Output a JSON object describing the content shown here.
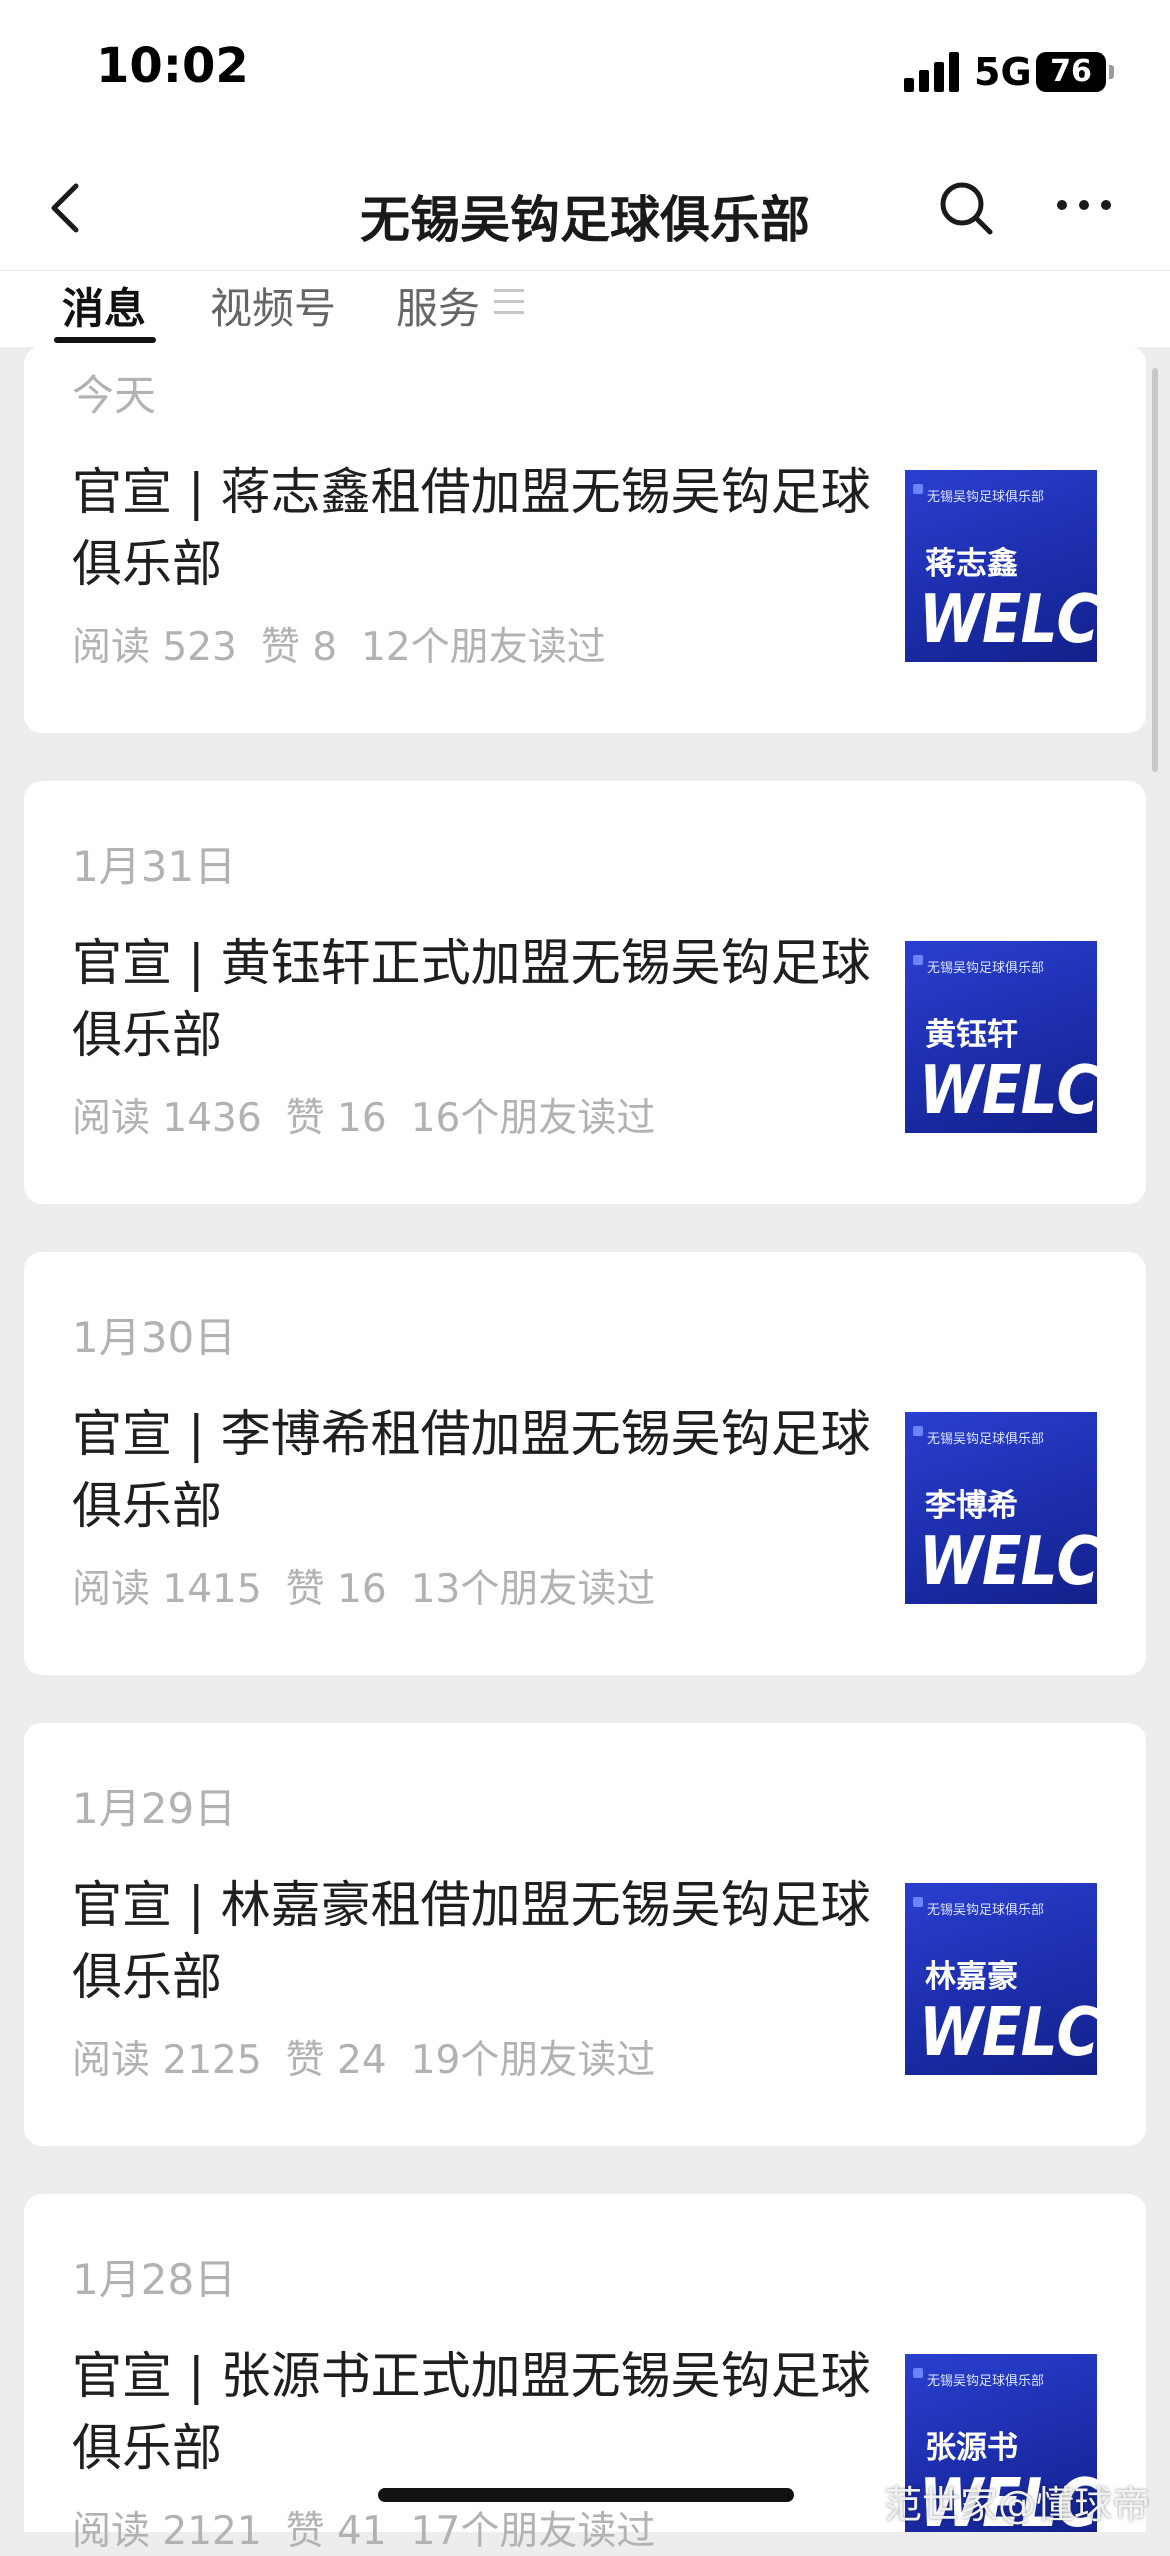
{
  "status_bar": {
    "time": "10:02",
    "network": "5G",
    "battery": "76"
  },
  "nav": {
    "title": "无锡吴钩足球俱乐部",
    "back_icon": "chevron-left-icon",
    "search_icon": "search-icon",
    "more_icon": "more-dots-icon"
  },
  "tabs": [
    {
      "label": "消息",
      "active": true
    },
    {
      "label": "视频号",
      "active": false
    },
    {
      "label": "服务",
      "active": false
    }
  ],
  "feed": [
    {
      "date": "今天",
      "title": "官宣 | 蒋志鑫租借加盟无锡吴钩足球俱乐部",
      "reads": "阅读 523",
      "likes": "赞 8",
      "friends": "12个朋友读过",
      "thumb_name": "蒋志鑫",
      "thumb_club": "无锡吴钩足球俱乐部",
      "thumb_text": "WELCOME"
    },
    {
      "date": "1月31日",
      "title": "官宣 | 黄钰轩正式加盟无锡吴钩足球俱乐部",
      "reads": "阅读 1436",
      "likes": "赞 16",
      "friends": "16个朋友读过",
      "thumb_name": "黄钰轩",
      "thumb_club": "无锡吴钩足球俱乐部",
      "thumb_text": "WELCOME"
    },
    {
      "date": "1月30日",
      "title": "官宣 | 李博希租借加盟无锡吴钩足球俱乐部",
      "reads": "阅读 1415",
      "likes": "赞 16",
      "friends": "13个朋友读过",
      "thumb_name": "李博希",
      "thumb_club": "无锡吴钩足球俱乐部",
      "thumb_text": "WELCOME"
    },
    {
      "date": "1月29日",
      "title": "官宣 | 林嘉豪租借加盟无锡吴钩足球俱乐部",
      "reads": "阅读 2125",
      "likes": "赞 24",
      "friends": "19个朋友读过",
      "thumb_name": "林嘉豪",
      "thumb_club": "无锡吴钩足球俱乐部",
      "thumb_text": "WELCOME"
    },
    {
      "date": "1月28日",
      "title": "官宣 | 张源书正式加盟无锡吴钩足球俱乐部",
      "reads": "阅读 2121",
      "likes": "赞 41",
      "friends": "17个朋友读过",
      "thumb_name": "张源书",
      "thumb_club": "无锡吴钩足球俱乐部",
      "thumb_text": "WELCOME"
    }
  ],
  "watermark": "范世家@懂球帝"
}
